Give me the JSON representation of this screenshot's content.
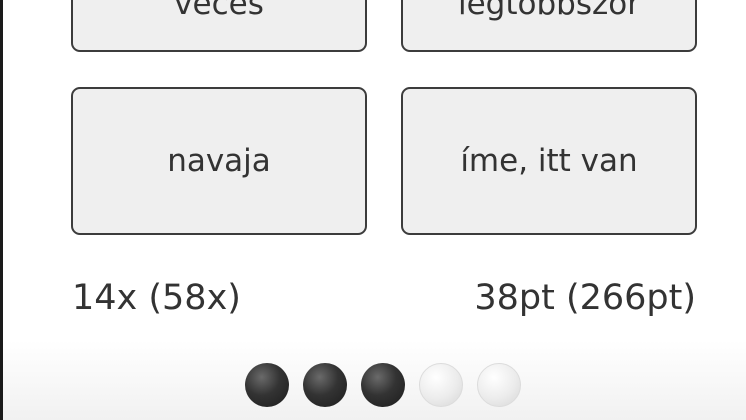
{
  "answers": [
    {
      "label": "veces"
    },
    {
      "label": "legtöbbször"
    },
    {
      "label": "navaja"
    },
    {
      "label": "íme, itt van"
    }
  ],
  "stats": {
    "left": "14x (58x)",
    "right": "38pt (266pt)"
  },
  "progress": {
    "completed": 3,
    "total": 5
  }
}
